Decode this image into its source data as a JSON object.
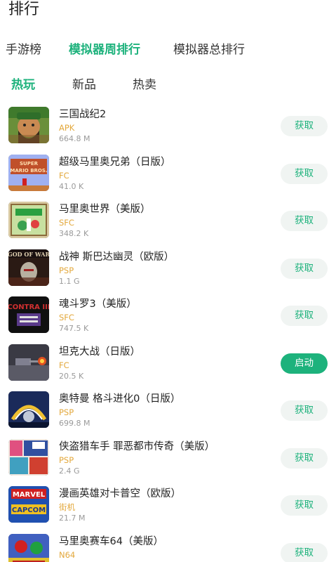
{
  "header": {
    "title": "排行"
  },
  "top_tabs": [
    {
      "label": "手游榜",
      "active": false
    },
    {
      "label": "模拟器周排行",
      "active": true
    },
    {
      "label": "模拟器总排行",
      "active": false
    }
  ],
  "sub_tabs": [
    {
      "label": "热玩",
      "active": true
    },
    {
      "label": "新品",
      "active": false
    },
    {
      "label": "热卖",
      "active": false
    }
  ],
  "colors": {
    "accent": "#1db27c",
    "platform": "#e3a83c",
    "size": "#9a9a9a",
    "button_bg": "#f0f4f2"
  },
  "games": [
    {
      "name": "三国战纪2",
      "platform": "APK",
      "size": "664.8 M",
      "action": "获取",
      "icon": "warrior-portrait-icon"
    },
    {
      "name": "超级马里奥兄弟（日版）",
      "platform": "FC",
      "size": "41.0 K",
      "action": "获取",
      "icon": "super-mario-bros-icon"
    },
    {
      "name": "马里奥世界（美版）",
      "platform": "SFC",
      "size": "348.2 K",
      "action": "获取",
      "icon": "mario-world-icon"
    },
    {
      "name": "战神 斯巴达幽灵（欧版）",
      "platform": "PSP",
      "size": "1.1 G",
      "action": "获取",
      "icon": "god-of-war-icon"
    },
    {
      "name": "魂斗罗3（美版）",
      "platform": "SFC",
      "size": "747.5 K",
      "action": "获取",
      "icon": "contra-icon"
    },
    {
      "name": "坦克大战（日版）",
      "platform": "FC",
      "size": "20.5 K",
      "action": "启动",
      "icon": "tank-battle-icon"
    },
    {
      "name": "奥特曼 格斗进化0（日版）",
      "platform": "PSP",
      "size": "699.8 M",
      "action": "获取",
      "icon": "ultraman-icon"
    },
    {
      "name": "侠盗猎车手 罪恶都市传奇（美版）",
      "platform": "PSP",
      "size": "2.4 G",
      "action": "获取",
      "icon": "gta-icon"
    },
    {
      "name": "漫画英雄对卡普空（欧版）",
      "platform": "街机",
      "size": "21.7 M",
      "action": "获取",
      "icon": "marvel-capcom-icon"
    },
    {
      "name": "马里奥赛车64（美版）",
      "platform": "N64",
      "size": "",
      "action": "获取",
      "icon": "mario-kart-icon"
    }
  ],
  "thumb_labels": {
    "super_mario": "SUPER MARIO BROS.",
    "god_of_war": "GOD OF WAR",
    "contra": "CONTRA III",
    "marvel": "MARVEL",
    "capcom": "CAPCOM"
  }
}
